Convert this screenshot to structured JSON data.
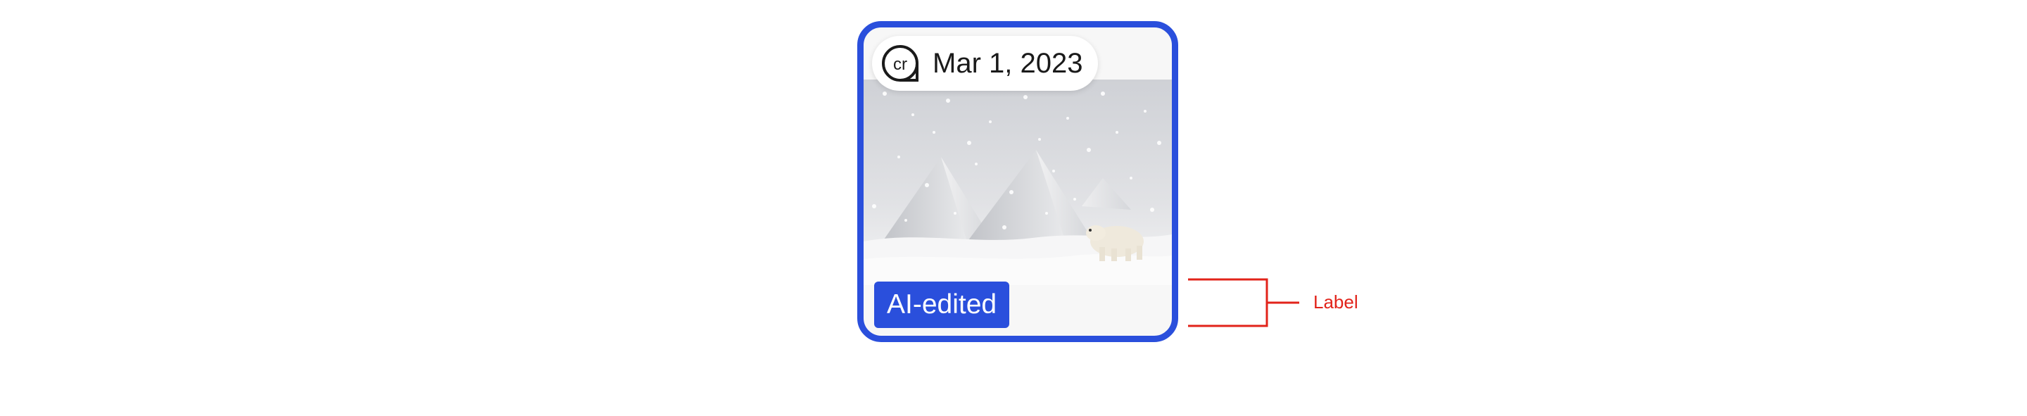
{
  "card": {
    "credential_icon": "content-credentials-cr-icon",
    "date": "Mar 1, 2023",
    "label": "AI-edited",
    "image_description_icon": "snowy-pyramids-polar-bear-image"
  },
  "annotation": {
    "text": "Label"
  },
  "colors": {
    "accent": "#2a4fdc",
    "annotation": "#e2231a",
    "card_background": "#f7f7f7"
  }
}
